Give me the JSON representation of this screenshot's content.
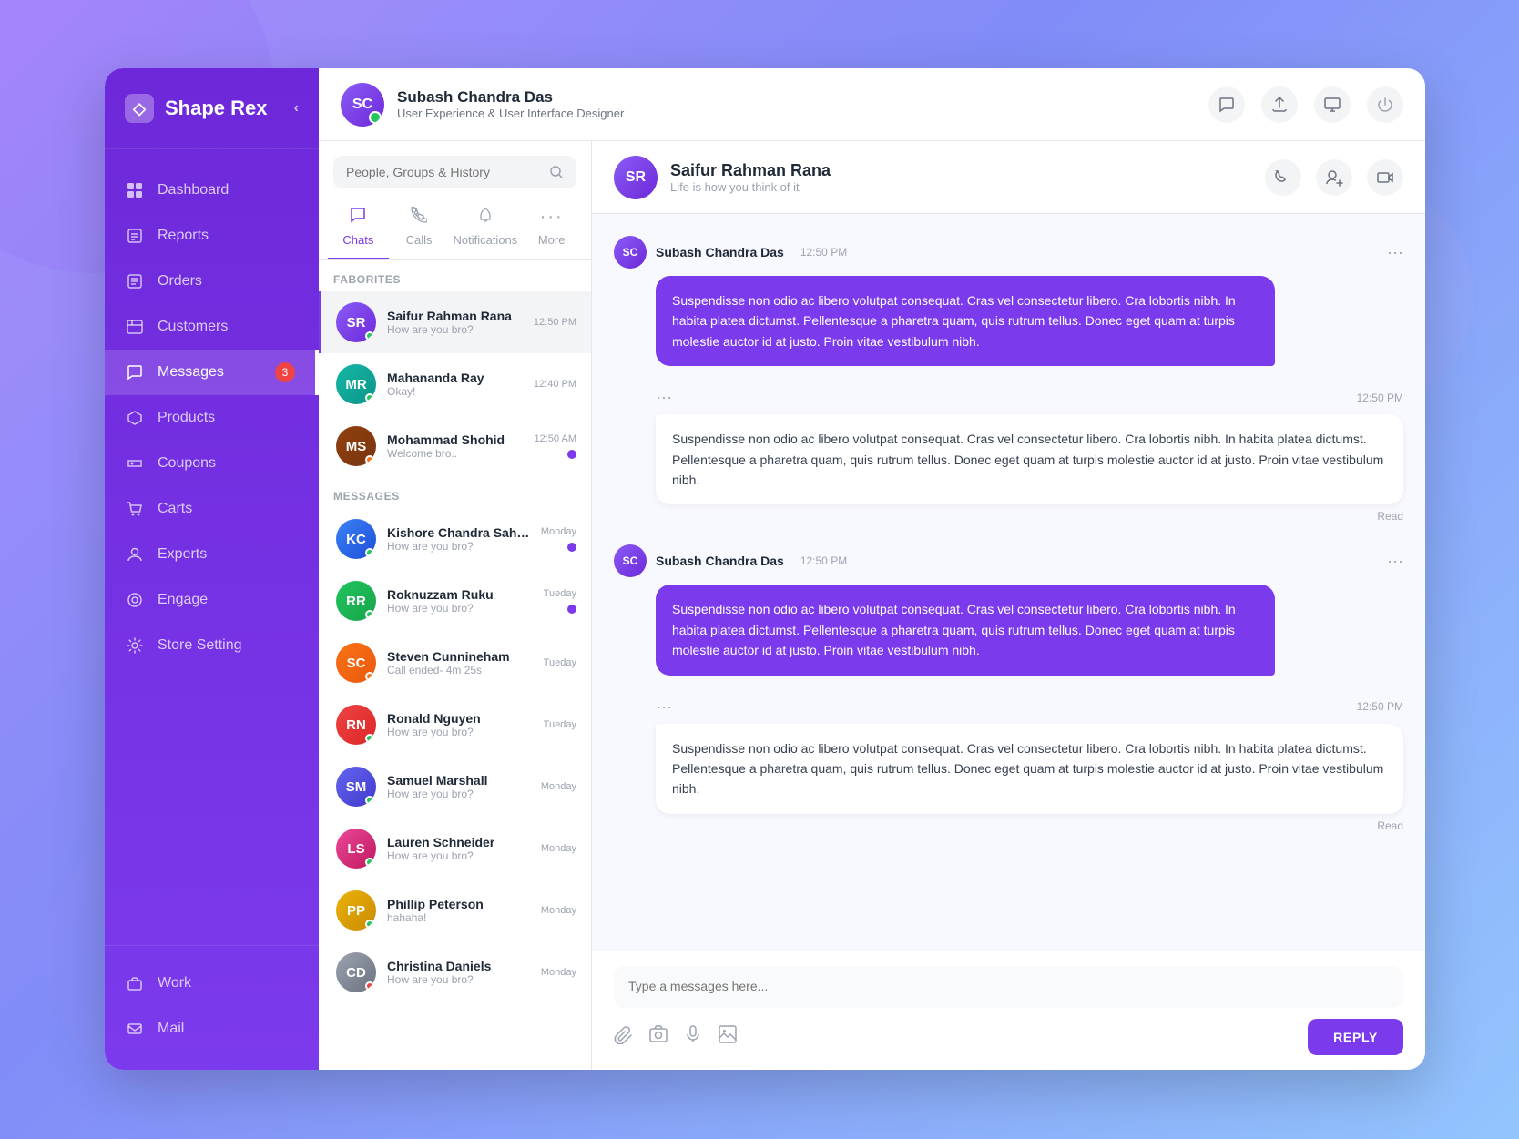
{
  "app": {
    "name": "Shape Rex",
    "logo_char": "◇"
  },
  "topbar": {
    "user": {
      "name": "Subash Chandra Das",
      "role": "User Experience & User Interface Designer",
      "initials": "SC"
    },
    "actions": {
      "chat_icon": "💬",
      "upload_icon": "☁",
      "monitor_icon": "🖥",
      "power_icon": "⏻"
    }
  },
  "sidebar": {
    "nav_items": [
      {
        "id": "dashboard",
        "label": "Dashboard",
        "icon": "⊞",
        "active": false
      },
      {
        "id": "reports",
        "label": "Reports",
        "icon": "📋",
        "active": false
      },
      {
        "id": "orders",
        "label": "Orders",
        "icon": "📄",
        "active": false
      },
      {
        "id": "customers",
        "label": "Customers",
        "icon": "🏪",
        "active": false
      },
      {
        "id": "messages",
        "label": "Messages",
        "icon": "💬",
        "active": true,
        "badge": "3"
      },
      {
        "id": "products",
        "label": "Products",
        "icon": "🎁",
        "active": false
      },
      {
        "id": "coupons",
        "label": "Coupons",
        "icon": "🏷",
        "active": false
      },
      {
        "id": "carts",
        "label": "Carts",
        "icon": "🛒",
        "active": false
      },
      {
        "id": "experts",
        "label": "Experts",
        "icon": "👤",
        "active": false
      },
      {
        "id": "engage",
        "label": "Engage",
        "icon": "◎",
        "active": false
      },
      {
        "id": "store-setting",
        "label": "Store Setting",
        "icon": "⚙",
        "active": false
      }
    ],
    "bottom_items": [
      {
        "id": "work",
        "label": "Work",
        "icon": "💼"
      },
      {
        "id": "mail",
        "label": "Mail",
        "icon": "✉"
      }
    ]
  },
  "chat_panel": {
    "search_placeholder": "People, Groups & History",
    "tabs": [
      {
        "id": "chats",
        "label": "Chats",
        "icon": "💬",
        "active": true
      },
      {
        "id": "calls",
        "label": "Calls",
        "icon": "📞",
        "active": false
      },
      {
        "id": "notifications",
        "label": "Notifications",
        "icon": "🔔",
        "active": false
      },
      {
        "id": "more",
        "label": "More",
        "icon": "⋯",
        "active": false
      }
    ],
    "favorites_label": "FABORITES",
    "favorites": [
      {
        "id": 1,
        "name": "Saifur Rahman Rana",
        "preview": "How are you bro?",
        "time": "12:50 PM",
        "online": "green",
        "initials": "SR",
        "av_class": "av-purple",
        "active": true
      },
      {
        "id": 2,
        "name": "Mahananda Ray",
        "preview": "Okay!",
        "time": "12:40 PM",
        "online": "green",
        "initials": "MR",
        "av_class": "av-teal"
      },
      {
        "id": 3,
        "name": "Mohammad Shohid",
        "preview": "Welcome bro..",
        "time": "12:50 AM",
        "online": "orange",
        "initials": "MS",
        "av_class": "av-brown",
        "unread": true
      }
    ],
    "messages_label": "MESSAGES",
    "messages": [
      {
        "id": 4,
        "name": "Kishore Chandra Sahoo",
        "preview": "How are you bro?",
        "time": "Monday",
        "online": "green",
        "initials": "KC",
        "av_class": "av-blue",
        "unread": true
      },
      {
        "id": 5,
        "name": "Roknuzzam Ruku",
        "preview": "How are you bro?",
        "time": "Tueday",
        "online": "green",
        "initials": "RR",
        "av_class": "av-green",
        "unread": true
      },
      {
        "id": 6,
        "name": "Steven Cunnineham",
        "preview": "Call ended- 4m 25s",
        "time": "Tueday",
        "online": "orange",
        "initials": "SC",
        "av_class": "av-orange"
      },
      {
        "id": 7,
        "name": "Ronald Nguyen",
        "preview": "How are you bro?",
        "time": "Tueday",
        "online": "green",
        "initials": "RN",
        "av_class": "av-red"
      },
      {
        "id": 8,
        "name": "Samuel Marshall",
        "preview": "How are you bro?",
        "time": "Monday",
        "online": "green",
        "initials": "SM",
        "av_class": "av-indigo"
      },
      {
        "id": 9,
        "name": "Lauren Schneider",
        "preview": "How are you bro?",
        "time": "Monday",
        "online": "green",
        "initials": "LS",
        "av_class": "av-pink"
      },
      {
        "id": 10,
        "name": "Phillip Peterson",
        "preview": "hahaha!",
        "time": "Monday",
        "online": "green",
        "initials": "PP",
        "av_class": "av-yellow"
      },
      {
        "id": 11,
        "name": "Christina Daniels",
        "preview": "How are you bro?",
        "time": "Monday",
        "online": "red",
        "initials": "CD",
        "av_class": "av-gray"
      }
    ]
  },
  "chat_view": {
    "contact": {
      "name": "Saifur Rahman Rana",
      "status": "Life is how you think of it",
      "initials": "SR"
    },
    "messages": [
      {
        "id": 1,
        "sender": "Subash Chandra Das",
        "time": "12:50 PM",
        "type": "sent",
        "text": "Suspendisse non odio ac libero volutpat consequat. Cras vel consectetur libero. Cra lobortis nibh. In habita platea dictumst. Pellentesque a pharetra quam, quis rutrum tellus. Donec eget quam at turpis molestie auctor id at justo. Proin vitae vestibulum nibh."
      },
      {
        "id": 2,
        "time": "12:50 PM",
        "type": "received",
        "text": "Suspendisse non odio ac libero volutpat consequat. Cras vel consectetur libero. Cra lobortis nibh. In habita platea dictumst. Pellentesque a pharetra quam, quis rutrum tellus. Donec eget quam at turpis molestie auctor id at justo. Proin vitae vestibulum nibh.",
        "read": true
      },
      {
        "id": 3,
        "sender": "Subash Chandra Das",
        "time": "12:50 PM",
        "type": "sent",
        "text": "Suspendisse non odio ac libero volutpat consequat. Cras vel consectetur libero. Cra lobortis nibh. In habita platea dictumst. Pellentesque a pharetra quam, quis rutrum tellus. Donec eget quam at turpis molestie auctor id at justo. Proin vitae vestibulum nibh."
      },
      {
        "id": 4,
        "time": "12:50 PM",
        "type": "received",
        "text": "Suspendisse non odio ac libero volutpat consequat. Cras vel consectetur libero. Cra lobortis nibh. In habita platea dictumst. Pellentesque a pharetra quam, quis rutrum tellus. Donec eget quam at turpis molestie auctor id at justo. Proin vitae vestibulum nibh.",
        "read": true
      }
    ],
    "input_placeholder": "Type a messages here...",
    "reply_label": "REPLY",
    "read_label": "Read",
    "dots": "...",
    "icons": {
      "attach": "📎",
      "camera": "📷",
      "mic": "🎤",
      "image": "🖼"
    }
  }
}
